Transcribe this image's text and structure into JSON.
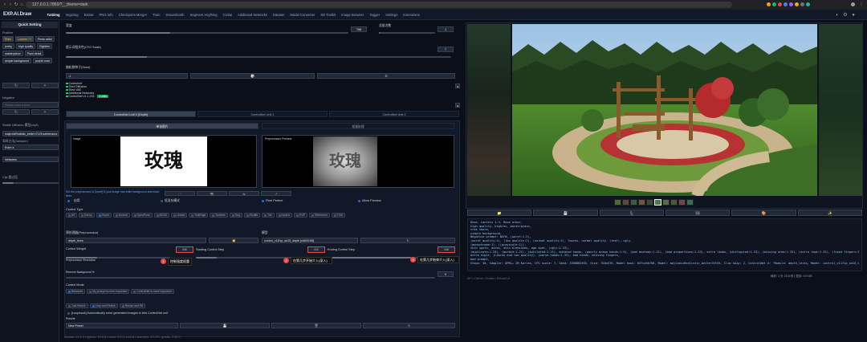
{
  "browser": {
    "url": "127.0.0.1:7860/?__theme=dark"
  },
  "app": {
    "logo": "EXP.AI.Draw",
    "tabs": [
      "Txt2img",
      "Img2img",
      "Extras",
      "PNG Info",
      "Checkpoint Merger",
      "Train",
      "Dreambooth",
      "Segment Anything",
      "Civitai",
      "Additional Networks",
      "Dataset",
      "Model Converter",
      "SD Toolkit",
      "Image Browser",
      "Tagger",
      "Settings",
      "Extensions"
    ]
  },
  "sidebar": {
    "title": "Quick Setting",
    "positive_label": "Positive",
    "chips": [
      "Plain",
      "Lowres / ?",
      "Photo artist",
      "pretty",
      "high quality",
      "Eighties",
      "masterpiece",
      "Plant detail",
      "simple background",
      "purple rose"
    ],
    "negative_label": "Negative",
    "negative_placeholder": "Please enter a term",
    "model_label": "Stable Diffusion 模型(ckpt)",
    "model_value": "majicmixRealistic_betterV2V25.safetensors",
    "sampler_label": "采样方法(Sampler)",
    "sampler_value": "Euler a",
    "network_label": "Networks",
    "clip_label": "Clip 跳过层"
  },
  "main": {
    "width_label": "宽度",
    "width_value": "768",
    "batch_count_label": "总批次数",
    "batch_count_value": "1",
    "cfg_label": "提示词相关性(CFG Scale)",
    "cfg_value": "7",
    "seed_label": "随机数种子(Seed)",
    "seed_value": "-1",
    "extras": [
      "Controlnet",
      "Tiled Diffusion",
      "Tiled VAE",
      "Additional Networks",
      "ControlNet v1.1.233"
    ],
    "controlnet_badge": "4 units",
    "unit_tabs": [
      "ControlNet Unit 0 [Depth]",
      "ControlNet Unit 1",
      "ControlNet Unit 2"
    ],
    "image_tabs": [
      "单张图片",
      "批量处理"
    ],
    "upload_label": "Image",
    "preview_label": "Preprocessor Preview",
    "hanzi_text": "玫瑰",
    "hint_text": "Set the preprocessor to [invert] If your image has white background and black lines.",
    "enable_label": "启用",
    "lowvram_label": "低显存模式",
    "pixel_perfect_label": "Pixel Perfect",
    "allow_preview_label": "Allow Preview",
    "control_type_label": "Control Type",
    "control_types": [
      "All",
      "Canny",
      "Depth",
      "Normal",
      "OpenPose",
      "MLSD",
      "Lineart",
      "SoftEdge",
      "Scribble",
      "Seg",
      "Shuffle",
      "Tile",
      "Inpaint",
      "IP2P",
      "Reference",
      "T2IA"
    ],
    "preprocessor_label": "预处理器(Preprocessor)",
    "preprocessor_value": "depth_leres",
    "model_label": "模型",
    "model_value": "control_v11f1p_sd15_depth [cfd03158]",
    "control_weight_label": "Control Weight",
    "control_weight_value": "0.6",
    "start_step_label": "Starting Control Step",
    "start_step_value": "0.2",
    "end_step_label": "Ending Control Step",
    "end_step_value": "0.8",
    "annotation_1": "控制强度权重",
    "annotation_2": "在第几步开始介入(深入)",
    "annotation_3": "在第几步结束介入(深入)",
    "badge_1": "1",
    "badge_2": "2",
    "badge_3": "3",
    "resolution_label": "Preprocessor Resolution",
    "resolution_value": "512",
    "remove_bg_label": "Remove Background %",
    "remove_bg_value": "0",
    "control_mode_label": "Control Mode",
    "control_modes": [
      "Balanced",
      "My prompt is more important",
      "ControlNet is more important"
    ],
    "resize_modes": [
      "Just Resize",
      "Crop and Resize",
      "Resize and Fill"
    ],
    "loopback_label": "[Loopback] Automatically send generated images to this ControlNet unit",
    "presets_label": "Presets",
    "presets_value": "New Preset"
  },
  "output": {
    "buttons": [
      "📁",
      "💾",
      "🗜",
      "🖼",
      "🎨",
      "✨"
    ],
    "info_lines": [
      "Rose, Lantern 1.3, Rose arbor,",
      "high quality, highres, masterpiece,",
      "tree shore,",
      "simple background,",
      "Negative prompt: NSFW, (worst:1.3),",
      "(worst quality:2), (low quality:2), (normal quality:2), lowres, normal quality, (text), ugly,",
      "(monochrome:1), ((grayscale:1)),",
      "skin spots, acnes, skin blemishes, age spot, (ugly:1.33),",
      "(duplicate:1.33), (morbid:1.21), (mutilated:1.21), mutated hands, (poorly drawn hands:1.5), (bad anatomy:1.21), (bad proportions:1.33), extra limbs, (disfigured:1.33), (missing arms:1.33), (extra legs:1.33), (fused fingers:1.61), (too many fingers:1.61), (unclear eyes:1.33),",
      "extra digit, (Lowres and low quality), (worse hands:1.33), bad hands, missing fingers,",
      "bad prompt,",
      "Steps: 30, Sampler: DPM++ 2M Karras, CFG scale: 7, Seed: 3396882035, Size: 768x576, Model hash: 03fca9b768, Model: majicmixRealistic_betterV2V25, Clip skip: 2, ControlNet 0: \"Module: depth_leres, Model: control_v11f1p_sd15_depth [cfd03158], Weight: 0.6, Resize Mode: Crop and Resize, Low Vram: False, Processor Res: 512, Threshold A: 0, Threshold B: 0, Guidance Start: 0.2, Guidance End: 0.8, Pixel Perfect: True, Control Mode: Balanced\", Version: v1.4.0"
    ],
    "time_text": "耗时: 1 分 23.8 秒 | 显存: 9.9 GB",
    "footer_text": "API  •  Github  •  Gradio  •  Reload UI"
  },
  "footer": {
    "text": "version: v1.4.0  •  python: 3.10.6  •  torch: 2.0.1+cu118  •  xformers: 0.0.20  •  gradio: 3.32.0"
  }
}
